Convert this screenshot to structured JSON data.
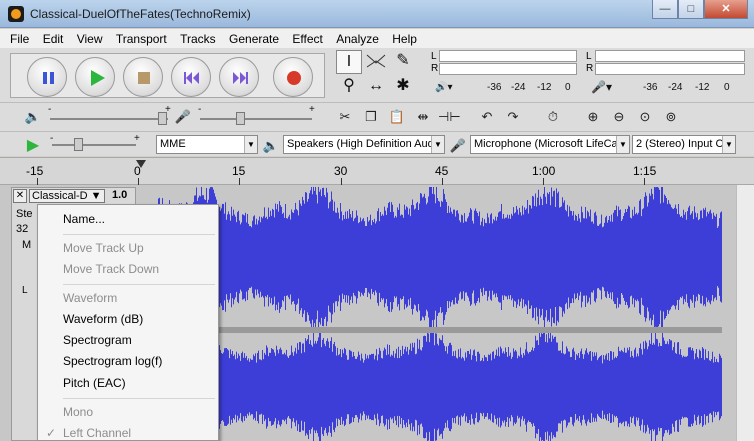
{
  "window": {
    "title": "Classical-DuelOfTheFates(TechnoRemix)"
  },
  "menubar": {
    "items": [
      "File",
      "Edit",
      "View",
      "Transport",
      "Tracks",
      "Generate",
      "Effect",
      "Analyze",
      "Help"
    ]
  },
  "meters": {
    "left_label": "L",
    "right_label": "R",
    "ticks": [
      "-36",
      "-24",
      "-12",
      "0"
    ]
  },
  "devices": {
    "host": "MME",
    "output": "Speakers (High Definition Audi",
    "input": "Microphone (Microsoft LifeCam",
    "channels": "2 (Stereo) Input C"
  },
  "slider_marks": {
    "minus": "-",
    "plus": "+"
  },
  "timeline": {
    "labels": [
      "-15",
      "0",
      "15",
      "30",
      "45",
      "1:00",
      "1:15"
    ]
  },
  "track": {
    "name": "Classical-D",
    "scale": "1.0",
    "info_line1": "Ste",
    "info_line2": "32",
    "info_line3": "M",
    "info_line4": "L"
  },
  "context_menu": {
    "items": [
      {
        "label": "Name...",
        "enabled": true
      },
      {
        "label": "Move Track Up",
        "enabled": false
      },
      {
        "label": "Move Track Down",
        "enabled": false
      },
      {
        "label": "Waveform",
        "enabled": false
      },
      {
        "label": "Waveform (dB)",
        "enabled": true
      },
      {
        "label": "Spectrogram",
        "enabled": true
      },
      {
        "label": "Spectrogram log(f)",
        "enabled": true
      },
      {
        "label": "Pitch (EAC)",
        "enabled": true
      },
      {
        "label": "Mono",
        "enabled": false
      },
      {
        "label": "Left Channel",
        "enabled": false,
        "checked": true
      }
    ]
  },
  "colors": {
    "waveform": "#3d3dd8",
    "waveform_bg": "#c7c7c7",
    "play": "#2db53c",
    "record": "#d83a2a"
  }
}
